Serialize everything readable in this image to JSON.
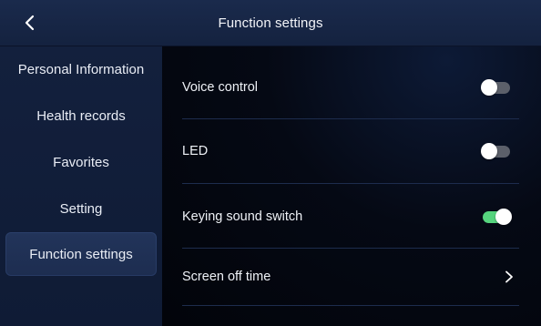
{
  "header": {
    "title": "Function settings",
    "back_icon": "chevron-left-icon"
  },
  "sidebar": {
    "items": [
      {
        "label": "Personal Information",
        "active": false
      },
      {
        "label": "Health records",
        "active": false
      },
      {
        "label": "Favorites",
        "active": false
      },
      {
        "label": "Setting",
        "active": false
      },
      {
        "label": "Function settings",
        "active": true
      }
    ]
  },
  "settings": {
    "voice_control": {
      "label": "Voice control",
      "enabled": false
    },
    "led": {
      "label": "LED",
      "enabled": false
    },
    "keying_sound": {
      "label": "Keying sound switch",
      "enabled": true
    },
    "screen_off": {
      "label": "Screen off time",
      "icon": "chevron-right-icon"
    }
  },
  "colors": {
    "toggle_on": "#56d47e",
    "toggle_off": "#5c606a",
    "header_bg": "#1a2a4c",
    "sidebar_bg": "#13203d"
  }
}
